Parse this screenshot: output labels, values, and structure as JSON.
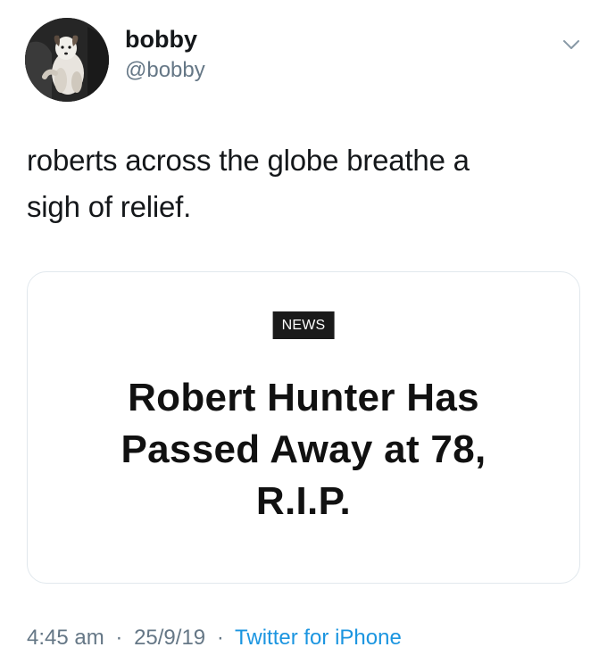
{
  "author": {
    "display_name": "bobby",
    "handle": "@bobby"
  },
  "icons": {
    "avatar": "dog-avatar",
    "menu": "chevron-down-icon"
  },
  "tweet": {
    "text_line1": "roberts across the globe breathe a",
    "text_line2": "sigh of relief."
  },
  "card": {
    "badge": "NEWS",
    "headline_line1": "Robert Hunter Has",
    "headline_line2": "Passed Away at 78,",
    "headline_line3": "R.I.P."
  },
  "meta": {
    "time": "4:45 am",
    "separator": "·",
    "date": "25/9/19",
    "source": "Twitter for iPhone"
  },
  "colors": {
    "link": "#1b95e0",
    "secondary_text": "#657786",
    "border": "#e1e8ed"
  }
}
